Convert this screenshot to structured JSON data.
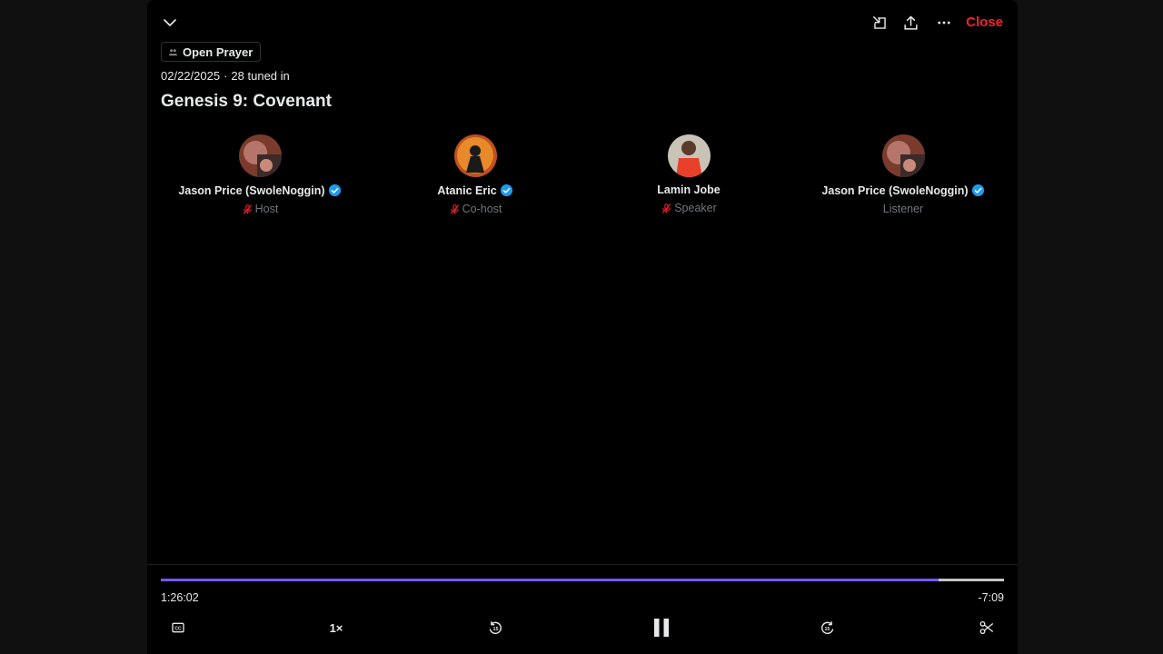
{
  "header": {
    "close_label": "Close",
    "icons": [
      "chevron-down-icon",
      "minimize-dock-icon",
      "share-icon",
      "more-icon"
    ]
  },
  "space": {
    "community": "Open Prayer",
    "date": "02/22/2025",
    "tuned_in": "28 tuned in",
    "title": "Genesis 9: Covenant"
  },
  "participants": [
    {
      "name": "Jason Price (SwoleNoggin)",
      "role": "Host",
      "verified": true,
      "muted": true
    },
    {
      "name": "Atanic Eric",
      "role": "Co-host",
      "verified": true,
      "muted": true
    },
    {
      "name": "Lamin Jobe",
      "role": "Speaker",
      "verified": false,
      "muted": true
    },
    {
      "name": "Jason Price (SwoleNoggin)",
      "role": "Listener",
      "verified": true,
      "muted": false
    }
  ],
  "player": {
    "elapsed": "1:26:02",
    "remaining": "-7:09",
    "progress_fraction": 0.922,
    "speed": "1×"
  },
  "colors": {
    "accent": "#7856ff",
    "close": "#f4212e",
    "verified": "#1d9bf0",
    "muted": "#f4212e"
  }
}
